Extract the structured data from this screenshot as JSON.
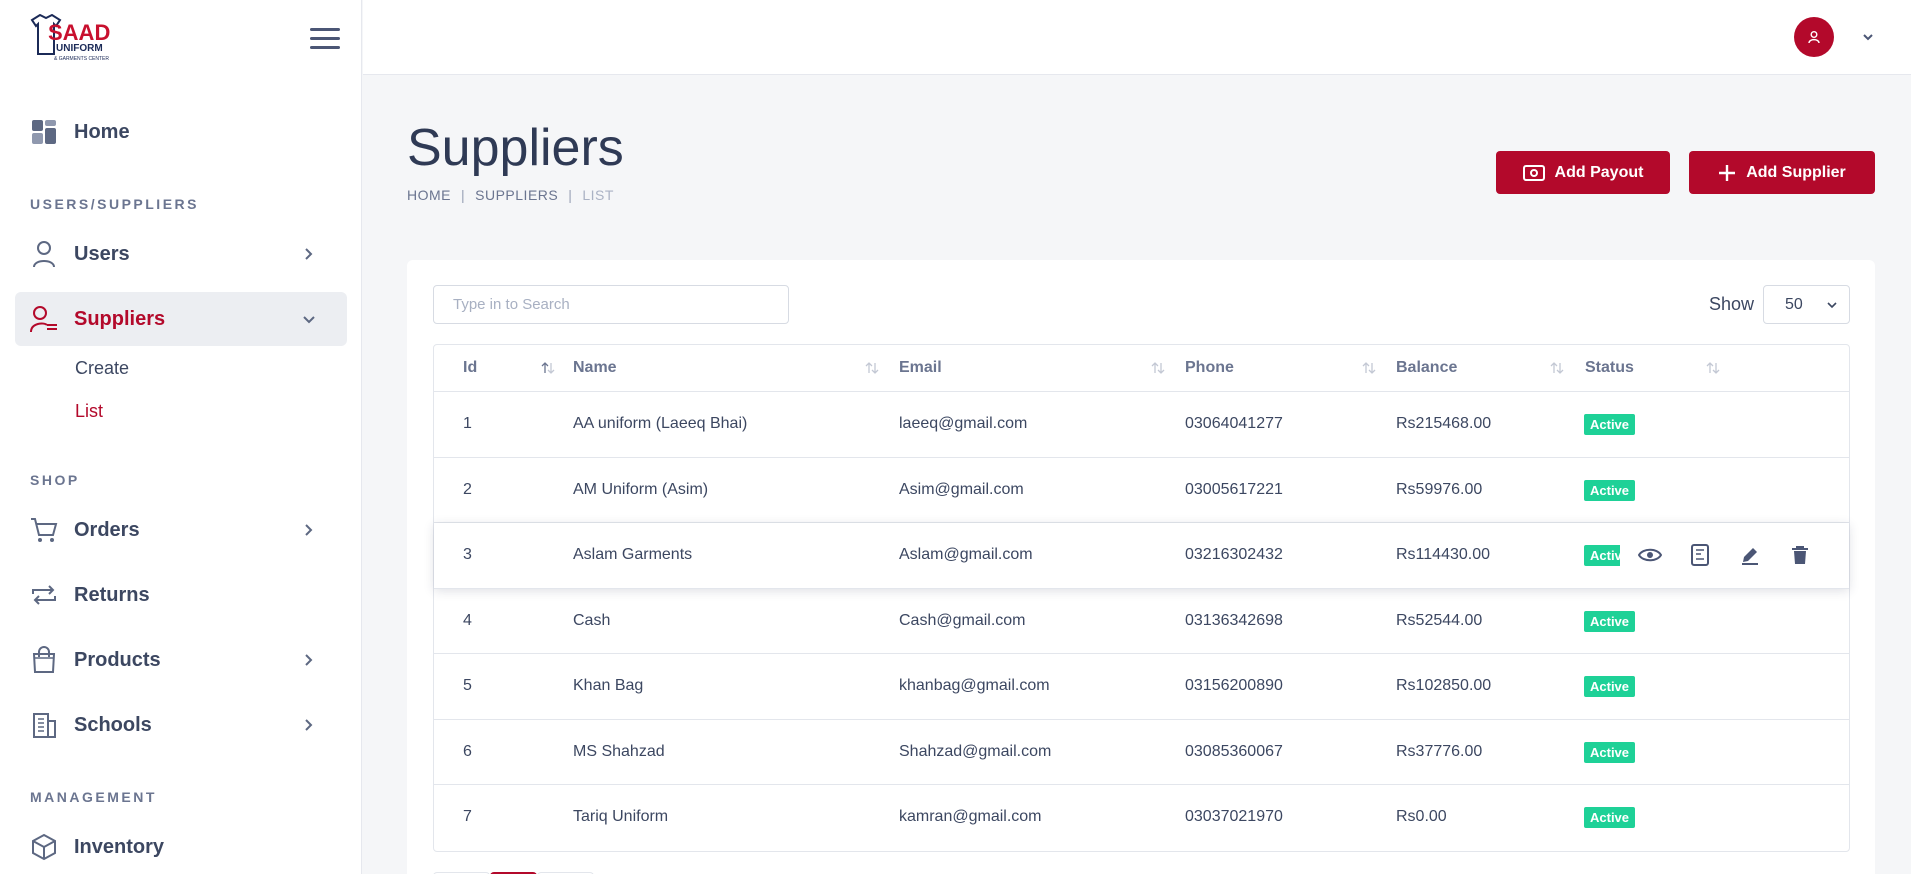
{
  "brand": {
    "logo_text": "SAAD",
    "logo_sub": "UNIFORM",
    "logo_sub2": "& GARMENTS CENTER",
    "accent": "#b3092b"
  },
  "sidebar": {
    "home": "Home",
    "section_users": "USERS/SUPPLIERS",
    "users": "Users",
    "suppliers": "Suppliers",
    "suppliers_sub": [
      "Create",
      "List"
    ],
    "section_shop": "SHOP",
    "orders": "Orders",
    "returns": "Returns",
    "products": "Products",
    "schools": "Schools",
    "section_management": "MANAGEMENT",
    "inventory": "Inventory"
  },
  "header": {
    "title": "Suppliers",
    "breadcrumb": [
      "HOME",
      "SUPPLIERS",
      "LIST"
    ],
    "add_payout": "Add Payout",
    "add_supplier": "Add Supplier"
  },
  "table_controls": {
    "search_placeholder": "Type in to Search",
    "show_label": "Show",
    "page_size": "50"
  },
  "table": {
    "columns": [
      "Id",
      "Name",
      "Email",
      "Phone",
      "Balance",
      "Status"
    ],
    "rows": [
      {
        "id": "1",
        "name": "AA uniform (Laeeq Bhai)",
        "email": "laeeq@gmail.com",
        "phone": "03064041277",
        "balance": "Rs215468.00",
        "status": "Active"
      },
      {
        "id": "2",
        "name": "AM Uniform (Asim)",
        "email": "Asim@gmail.com",
        "phone": "03005617221",
        "balance": "Rs59976.00",
        "status": "Active"
      },
      {
        "id": "3",
        "name": "Aslam Garments",
        "email": "Aslam@gmail.com",
        "phone": "03216302432",
        "balance": "Rs114430.00",
        "status": "Active"
      },
      {
        "id": "4",
        "name": "Cash",
        "email": "Cash@gmail.com",
        "phone": "03136342698",
        "balance": "Rs52544.00",
        "status": "Active"
      },
      {
        "id": "5",
        "name": "Khan Bag",
        "email": "khanbag@gmail.com",
        "phone": "03156200890",
        "balance": "Rs102850.00",
        "status": "Active"
      },
      {
        "id": "6",
        "name": "MS Shahzad",
        "email": "Shahzad@gmail.com",
        "phone": "03085360067",
        "balance": "Rs37776.00",
        "status": "Active"
      },
      {
        "id": "7",
        "name": "Tariq Uniform",
        "email": "kamran@gmail.com",
        "phone": "03037021970",
        "balance": "Rs0.00",
        "status": "Active"
      }
    ]
  },
  "colors": {
    "accent": "#b3092b",
    "status_active": "#1ed197"
  }
}
